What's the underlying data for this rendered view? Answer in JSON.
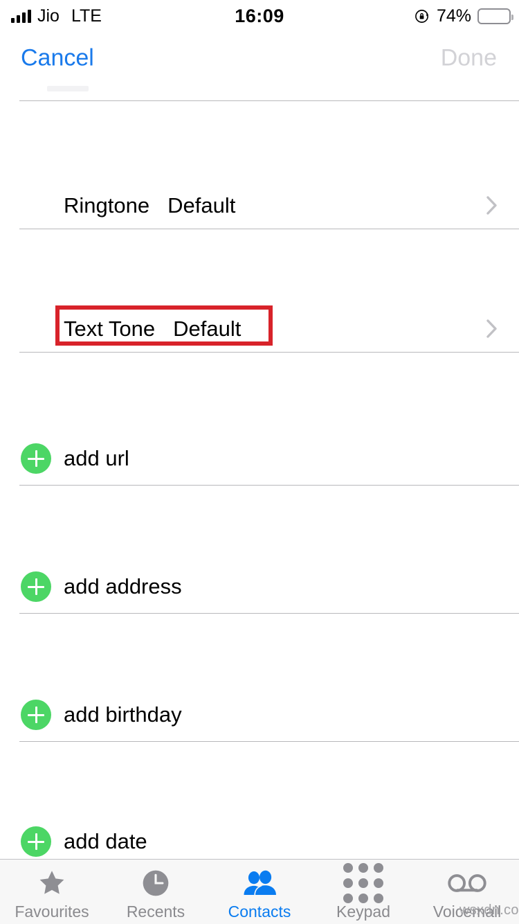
{
  "status_bar": {
    "carrier": "Jio",
    "network": "LTE",
    "time": "16:09",
    "battery_percent": "74%",
    "battery_level": 74,
    "signal_bars": 4,
    "rotation_lock_icon": "rotation-lock-icon"
  },
  "nav_bar": {
    "cancel_label": "Cancel",
    "done_label": "Done",
    "cancel_color": "#1a7aeb",
    "done_color": "#d2d2d6"
  },
  "rows": [
    {
      "type": "value",
      "name": "ringtone",
      "label": "Ringtone",
      "value": "Default",
      "chevron": true
    },
    {
      "type": "value",
      "name": "text-tone",
      "label": "Text Tone",
      "value": "Default",
      "chevron": true
    },
    {
      "type": "add",
      "name": "add-url",
      "label": "add url"
    },
    {
      "type": "add",
      "name": "add-address",
      "label": "add address"
    },
    {
      "type": "add",
      "name": "add-birthday",
      "label": "add birthday"
    },
    {
      "type": "add",
      "name": "add-date",
      "label": "add date"
    }
  ],
  "annotation": {
    "target": "Text Tone",
    "color": "#d8232a"
  },
  "tab_bar": {
    "active_color": "#0a7cf0",
    "inactive_color": "#8a8a8e",
    "items": [
      {
        "label": "Favourites",
        "icon": "star-icon",
        "active": false
      },
      {
        "label": "Recents",
        "icon": "clock-icon",
        "active": false
      },
      {
        "label": "Contacts",
        "icon": "people-icon",
        "active": true
      },
      {
        "label": "Keypad",
        "icon": "keypad-dots-icon",
        "active": false
      },
      {
        "label": "Voicemail",
        "icon": "voicemail-icon",
        "active": false
      }
    ]
  },
  "watermark": {
    "text": "wsxdn.com"
  },
  "theme": {
    "add_button_green": "#4cd665",
    "separator": "#b8b8bb"
  }
}
